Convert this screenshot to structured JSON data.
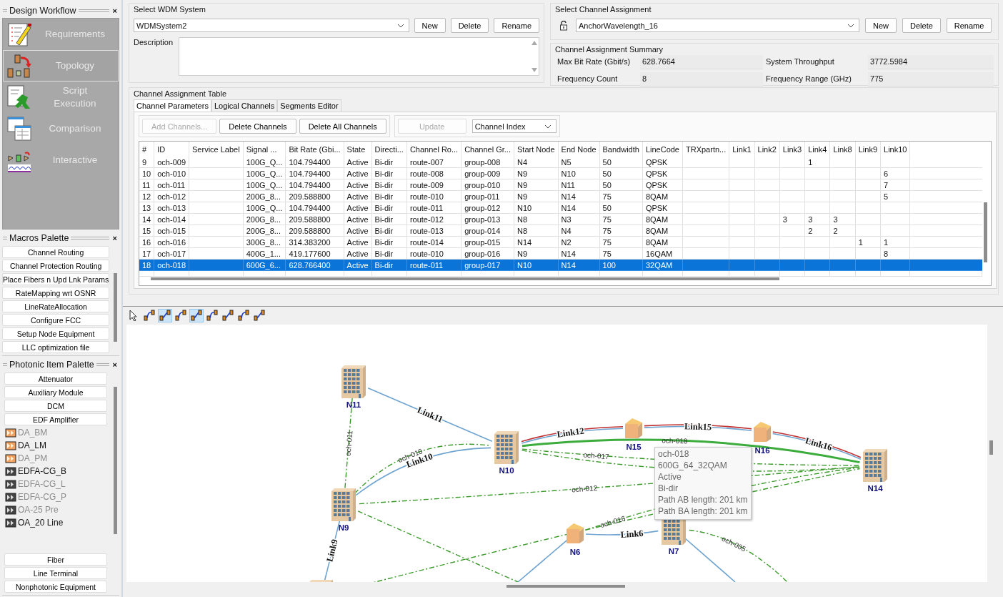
{
  "sidebar": {
    "panels": [
      {
        "kind": "workflow",
        "title": "Design Workflow",
        "close": "×",
        "items": [
          {
            "label": "Requirements",
            "kind": "requirements",
            "selected": false
          },
          {
            "label": "Topology",
            "kind": "topology",
            "selected": true
          },
          {
            "label": "Script Execution",
            "kind": "script",
            "selected": false
          },
          {
            "label": "Comparison",
            "kind": "comparison",
            "selected": false
          },
          {
            "label": "Interactive",
            "kind": "interactive",
            "selected": false
          }
        ]
      },
      {
        "kind": "buttons",
        "title": "Macros Palette",
        "close": "×",
        "items": [
          {
            "label": "Channel Routing"
          },
          {
            "label": "Channel Protection Routing"
          },
          {
            "label": "Place Fibers n Upd Lnk Params"
          },
          {
            "label": "RateMapping wrt OSNR"
          },
          {
            "label": "LineRateAllocation"
          },
          {
            "label": "Configure FCC"
          },
          {
            "label": "Setup Node Equipment"
          },
          {
            "label": "LLC optimization file"
          }
        ]
      },
      {
        "kind": "palette",
        "title": "Photonic Item Palette",
        "close": "×",
        "items": [
          {
            "kind": "button",
            "label": "Attenuator"
          },
          {
            "kind": "button",
            "label": "Auxiliary Module"
          },
          {
            "kind": "button",
            "label": "DCM"
          },
          {
            "kind": "button",
            "label": "EDF Amplifier"
          },
          {
            "kind": "orange-amp",
            "label": "DA_BM",
            "disabled": true
          },
          {
            "kind": "orange-amp",
            "label": "DA_LM",
            "disabled": false
          },
          {
            "kind": "orange-amp",
            "label": "DA_PM",
            "disabled": true
          },
          {
            "kind": "dark-amp",
            "label": "EDFA-CG_B",
            "disabled": false
          },
          {
            "kind": "dark-amp",
            "label": "EDFA-CG_L",
            "disabled": true
          },
          {
            "kind": "dark-amp",
            "label": "EDFA-CG_P",
            "disabled": true
          },
          {
            "kind": "dark-amp",
            "label": "OA-25 Pre",
            "disabled": true
          },
          {
            "kind": "dark-amp",
            "label": "OA_20 Line",
            "disabled": false
          },
          {
            "kind": "gap"
          },
          {
            "kind": "button",
            "label": "Fiber"
          },
          {
            "kind": "button",
            "label": "Line Terminal"
          },
          {
            "kind": "button",
            "label": "Nonphotonic Equipment"
          }
        ]
      }
    ]
  },
  "wdm_system": {
    "legend": "Select WDM System",
    "value": "WDMSystem2",
    "buttons": [
      "New",
      "Delete",
      "Rename"
    ],
    "description_label": "Description"
  },
  "channel_assignment": {
    "legend": "Select Channel Assignment",
    "value": "AnchorWavelength_16",
    "buttons": [
      "New",
      "Delete",
      "Rename"
    ],
    "summary": {
      "legend": "Channel Assignment Summary",
      "fields": [
        {
          "label": "Max Bit Rate (Gbit/s)",
          "value": "628.7664"
        },
        {
          "label": "System Throughput",
          "value": "3772.5984"
        },
        {
          "label": "Frequency Count",
          "value": "8"
        },
        {
          "label": "Frequency Range (GHz)",
          "value": "775"
        }
      ]
    }
  },
  "table": {
    "legend": "Channel Assignment Table",
    "tabs": [
      {
        "label": "Channel Parameters",
        "selected": true
      },
      {
        "label": "Logical Channels",
        "selected": false
      },
      {
        "label": "Segments Editor",
        "selected": false
      }
    ],
    "actions": [
      {
        "label": "Add Channels...",
        "disabled": true
      },
      {
        "label": "Delete Channels",
        "disabled": false
      },
      {
        "label": "Delete All Channels",
        "disabled": false
      }
    ],
    "update": {
      "label": "Update",
      "disabled": true
    },
    "sort": "Channel Index",
    "columns": [
      "#",
      "ID",
      "Service Label",
      "Signal ...",
      "Bit Rate (Gbi...",
      "State",
      "Directi...",
      "Channel Ro...",
      "Channel Gr...",
      "Start Node",
      "End Node",
      "Bandwidth",
      "LineCode",
      "TRXpartn...",
      "Link1",
      "Link2",
      "Link3",
      "Link4",
      "Link8",
      "Link9",
      "Link10"
    ],
    "rows": [
      {
        "selected": false,
        "cells": [
          "9",
          "och-009",
          null,
          "100G_Q...",
          "104.794400",
          "Active",
          "Bi-dir",
          "route-007",
          "group-008",
          "N4",
          "N5",
          "50",
          "QPSK",
          null,
          null,
          null,
          null,
          "1",
          null,
          null,
          null
        ]
      },
      {
        "selected": false,
        "cells": [
          "10",
          "och-010",
          null,
          "100G_Q...",
          "104.794400",
          "Active",
          "Bi-dir",
          "route-008",
          "group-009",
          "N9",
          "N10",
          "50",
          "QPSK",
          null,
          null,
          null,
          null,
          null,
          null,
          null,
          "6"
        ]
      },
      {
        "selected": false,
        "cells": [
          "11",
          "och-011",
          null,
          "100G_Q...",
          "104.794400",
          "Active",
          "Bi-dir",
          "route-009",
          "group-010",
          "N9",
          "N11",
          "50",
          "QPSK",
          null,
          null,
          null,
          null,
          null,
          null,
          null,
          "7"
        ]
      },
      {
        "selected": false,
        "cells": [
          "12",
          "och-012",
          null,
          "200G_8...",
          "209.588800",
          "Active",
          "Bi-dir",
          "route-010",
          "group-011",
          "N9",
          "N14",
          "75",
          "8QAM",
          null,
          null,
          null,
          null,
          null,
          null,
          null,
          "5"
        ]
      },
      {
        "selected": false,
        "cells": [
          "13",
          "och-013",
          null,
          "100G_Q...",
          "104.794400",
          "Active",
          "Bi-dir",
          "route-011",
          "group-012",
          "N10",
          "N14",
          "50",
          "QPSK",
          null,
          null,
          null,
          null,
          null,
          null,
          null,
          null
        ]
      },
      {
        "selected": false,
        "cells": [
          "14",
          "och-014",
          null,
          "200G_8...",
          "209.588800",
          "Active",
          "Bi-dir",
          "route-012",
          "group-013",
          "N8",
          "N3",
          "75",
          "8QAM",
          null,
          null,
          null,
          "3",
          "3",
          "3",
          null,
          null
        ]
      },
      {
        "selected": false,
        "cells": [
          "15",
          "och-015",
          null,
          "200G_8...",
          "209.588800",
          "Active",
          "Bi-dir",
          "route-013",
          "group-014",
          "N8",
          "N4",
          "75",
          "8QAM",
          null,
          null,
          null,
          null,
          "2",
          "2",
          null,
          null
        ]
      },
      {
        "selected": false,
        "cells": [
          "16",
          "och-016",
          null,
          "300G_8...",
          "314.383200",
          "Active",
          "Bi-dir",
          "route-014",
          "group-015",
          "N14",
          "N2",
          "75",
          "8QAM",
          null,
          null,
          null,
          null,
          null,
          null,
          "1",
          "1"
        ]
      },
      {
        "selected": false,
        "cells": [
          "17",
          "och-017",
          null,
          "400G_1...",
          "419.177600",
          "Active",
          "Bi-dir",
          "route-010",
          "group-016",
          "N9",
          "N14",
          "75",
          "16QAM",
          null,
          null,
          null,
          null,
          null,
          null,
          null,
          "8"
        ]
      },
      {
        "selected": true,
        "cells": [
          "18",
          "och-018",
          null,
          "600G_6...",
          "628.766400",
          "Active",
          "Bi-dir",
          "route-011",
          "group-017",
          "N10",
          "N14",
          "100",
          "32QAM",
          null,
          null,
          null,
          null,
          null,
          null,
          null,
          null
        ]
      }
    ]
  },
  "diagram": {
    "tools": [
      {
        "kind": "pointer",
        "selected": false
      },
      {
        "kind": "tool",
        "selected": false
      },
      {
        "kind": "tool",
        "selected": true
      },
      {
        "kind": "tool",
        "selected": false
      },
      {
        "kind": "tool",
        "selected": true
      },
      {
        "kind": "tool",
        "selected": false
      },
      {
        "kind": "tool",
        "selected": false
      },
      {
        "kind": "tool",
        "selected": false
      },
      {
        "kind": "tool",
        "selected": false
      }
    ],
    "nodes": [
      {
        "label": "N11",
        "kind": "building"
      },
      {
        "label": "N10",
        "kind": "building"
      },
      {
        "label": "N15",
        "kind": "house"
      },
      {
        "label": "N16",
        "kind": "house"
      },
      {
        "label": "N14",
        "kind": "building"
      },
      {
        "label": "N9",
        "kind": "building"
      },
      {
        "label": "N6",
        "kind": "house"
      },
      {
        "label": "N7",
        "kind": "building"
      },
      {
        "kind": "building"
      }
    ],
    "links": [
      {
        "label": "Link11",
        "kind": "single"
      },
      {
        "label": "Link12",
        "kind": "dual"
      },
      {
        "label": "Link15",
        "kind": "dual"
      },
      {
        "label": "Link16",
        "kind": "dual"
      },
      {
        "label": "Link10",
        "kind": "single"
      },
      {
        "label": "Link9",
        "kind": "single"
      },
      {
        "label": "Link6",
        "kind": "single"
      },
      {
        "kind": "single"
      },
      {
        "kind": "single"
      }
    ],
    "channels": [
      {
        "label": "och-011",
        "selected": false
      },
      {
        "label": "och-010",
        "selected": false
      },
      {
        "label": "och-018",
        "selected": true
      },
      {
        "label": "och-017",
        "selected": false
      },
      {
        "label": "och-012",
        "selected": false
      },
      {
        "selected": false
      },
      {
        "label": "och-016",
        "selected": false
      },
      {
        "selected": false
      },
      {
        "label": "och-005",
        "selected": false
      },
      {
        "selected": false
      }
    ],
    "tooltip": [
      "och-018",
      "600G_64_32QAM",
      "Active",
      "Bi-dir",
      "Path AB length: 201 km",
      "Path BA length: 201 km"
    ]
  }
}
